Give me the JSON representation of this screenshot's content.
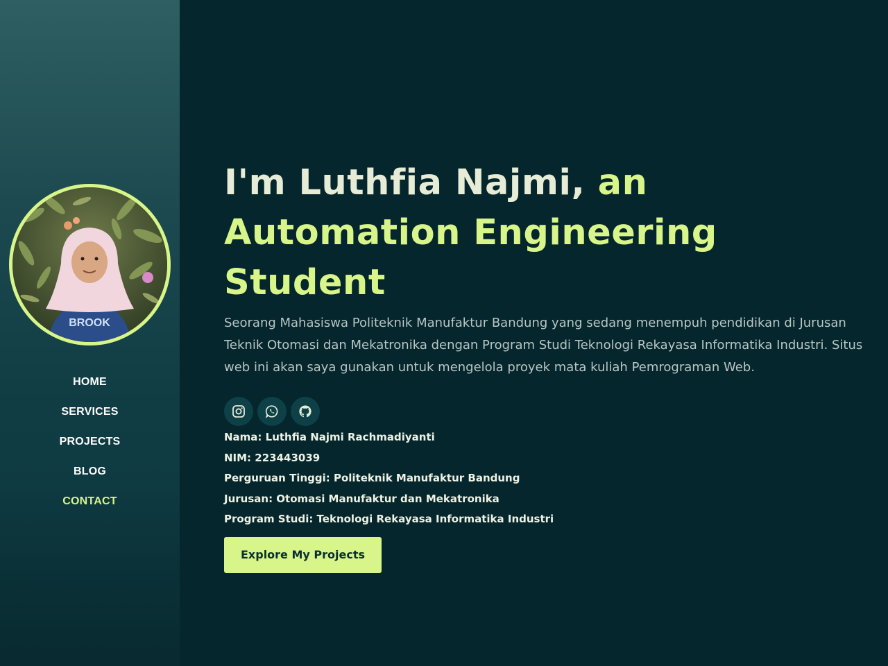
{
  "nav": {
    "items": [
      {
        "label": "HOME"
      },
      {
        "label": "SERVICES"
      },
      {
        "label": "PROJECTS"
      },
      {
        "label": "BLOG"
      },
      {
        "label": "CONTACT"
      }
    ]
  },
  "hero": {
    "headline_intro": "I'm Luthfia Najmi,",
    "headline_accent": "an Automation Engineering Student",
    "description": "Seorang Mahasiswa Politeknik Manufaktur Bandung yang sedang menempuh pendidikan di Jurusan Teknik Otomasi dan Mekatronika dengan Program Studi Teknologi Rekayasa Informatika Industri. Situs web ini akan saya gunakan untuk mengelola proyek mata kuliah Pemrograman Web.",
    "socials": [
      {
        "icon": "instagram-icon"
      },
      {
        "icon": "whatsapp-icon"
      },
      {
        "icon": "github-icon"
      }
    ],
    "info": [
      "Nama: Luthfia Najmi Rachmadiyanti",
      "NIM: 223443039",
      "Perguruan Tinggi: Politeknik Manufaktur Bandung",
      "Jurusan: Otomasi Manufaktur dan Mekatronika",
      "Program Studi: Teknologi Rekayasa Informatika Industri"
    ],
    "cta_label": "Explore My Projects"
  },
  "colors": {
    "accent": "#d8f58a",
    "background": "#05262d",
    "sidebar_top": "#2f5f62",
    "text_muted": "#b9c6c4"
  }
}
